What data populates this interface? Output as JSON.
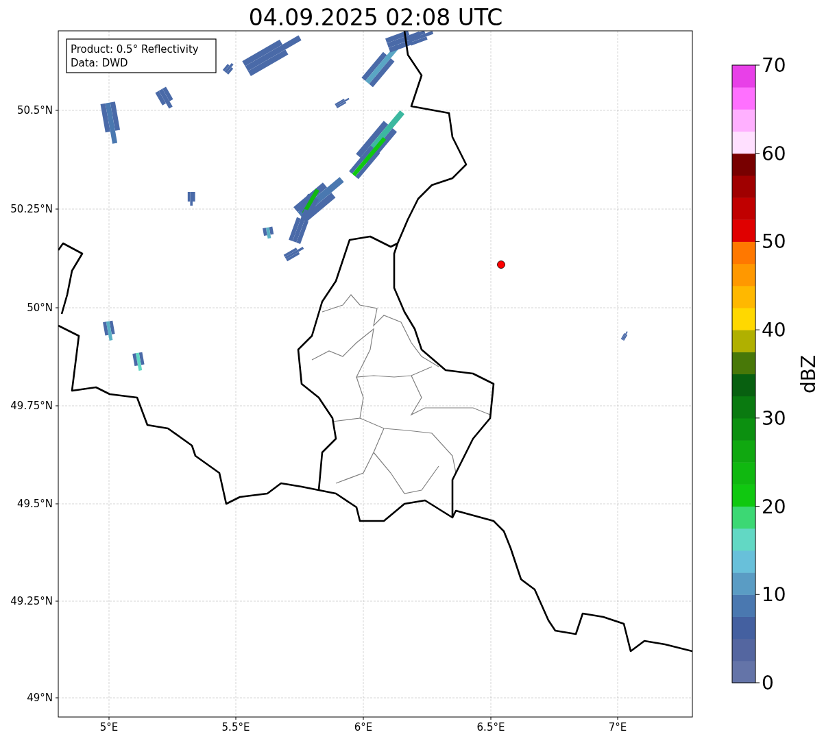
{
  "title": "04.09.2025 02:08 UTC",
  "info_box": {
    "lines": [
      "Product: 0.5° Reflectivity",
      "Data: DWD"
    ]
  },
  "map": {
    "yticks": [
      "50.5°N",
      "50.25°N",
      "50°N",
      "49.75°N",
      "49.5°N",
      "49.25°N",
      "49°N"
    ],
    "xticks": [
      "5°E",
      "5.5°E",
      "6°E",
      "6.5°E",
      "7°E"
    ]
  },
  "colorbar": {
    "label": "dBZ",
    "ticks": [
      "70",
      "60",
      "50",
      "40",
      "30",
      "20",
      "10",
      "0"
    ],
    "bands": [
      {
        "color": "#6474a8"
      },
      {
        "color": "#5466a0"
      },
      {
        "color": "#4460a0"
      },
      {
        "color": "#4a78b0"
      },
      {
        "color": "#5a9cc4"
      },
      {
        "color": "#68c0da"
      },
      {
        "color": "#62d8c4"
      },
      {
        "color": "#3cd874"
      },
      {
        "color": "#10c810"
      },
      {
        "color": "#10b810"
      },
      {
        "color": "#10a810"
      },
      {
        "color": "#0c9010"
      },
      {
        "color": "#0a7a10"
      },
      {
        "color": "#086010"
      },
      {
        "color": "#487808"
      },
      {
        "color": "#b0b000"
      },
      {
        "color": "#ffd800"
      },
      {
        "color": "#ffb800"
      },
      {
        "color": "#ff9800"
      },
      {
        "color": "#ff7800"
      },
      {
        "color": "#e00000"
      },
      {
        "color": "#c00000"
      },
      {
        "color": "#a00000"
      },
      {
        "color": "#780000"
      },
      {
        "color": "#ffe0ff"
      },
      {
        "color": "#ffb0ff"
      },
      {
        "color": "#ff70ff"
      },
      {
        "color": "#e840e8"
      }
    ]
  }
}
